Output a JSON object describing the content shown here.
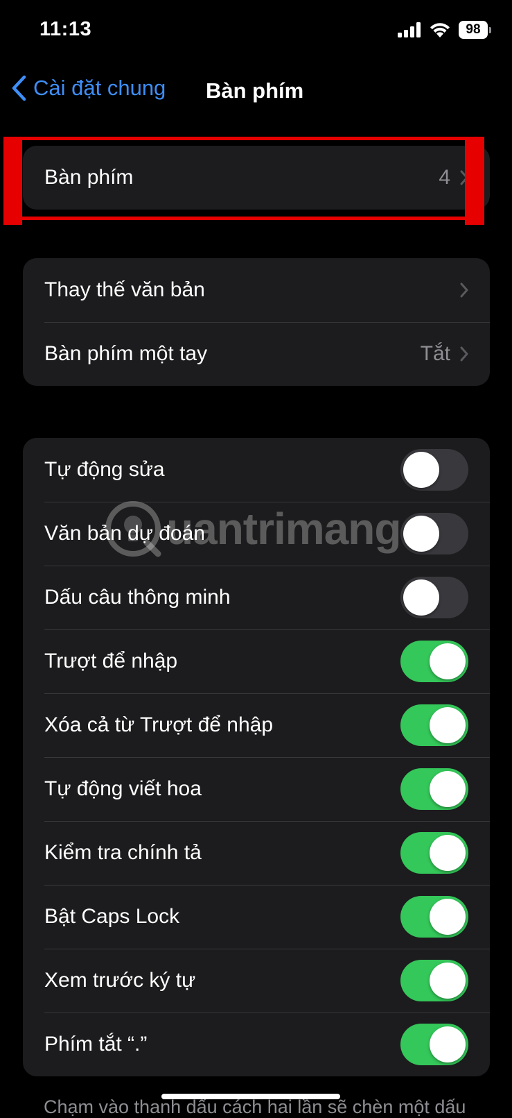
{
  "status_bar": {
    "time": "11:13",
    "battery_level": "98",
    "icons": [
      "cellular-signal-icon",
      "wifi-icon",
      "battery-icon"
    ]
  },
  "nav": {
    "back_label": "Cài đặt chung",
    "title": "Bàn phím"
  },
  "group1": {
    "keyboards": {
      "label": "Bàn phím",
      "value": "4"
    }
  },
  "group2": {
    "text_replacement": {
      "label": "Thay thế văn bản"
    },
    "one_handed": {
      "label": "Bàn phím một tay",
      "value": "Tắt"
    }
  },
  "group3": {
    "toggles": [
      {
        "label": "Tự động sửa",
        "on": false
      },
      {
        "label": "Văn bản dự đoán",
        "on": false
      },
      {
        "label": "Dấu câu thông minh",
        "on": false
      },
      {
        "label": "Trượt để nhập",
        "on": true
      },
      {
        "label": "Xóa cả từ Trượt để nhập",
        "on": true
      },
      {
        "label": "Tự động viết hoa",
        "on": true
      },
      {
        "label": "Kiểm tra chính tả",
        "on": true
      },
      {
        "label": "Bật Caps Lock",
        "on": true
      },
      {
        "label": "Xem trước ký tự",
        "on": true
      },
      {
        "label": "Phím tắt “.”",
        "on": true
      }
    ]
  },
  "footer": {
    "text": "Chạm vào thanh dấu cách hai lần sẽ chèn một dấu"
  },
  "watermark": {
    "text": "uantrimang"
  },
  "colors": {
    "background": "#000000",
    "cell": "#1c1c1e",
    "accent": "#3e8ef7",
    "toggle_on": "#34c759",
    "toggle_off": "#39393d",
    "highlight": "#e60000"
  }
}
